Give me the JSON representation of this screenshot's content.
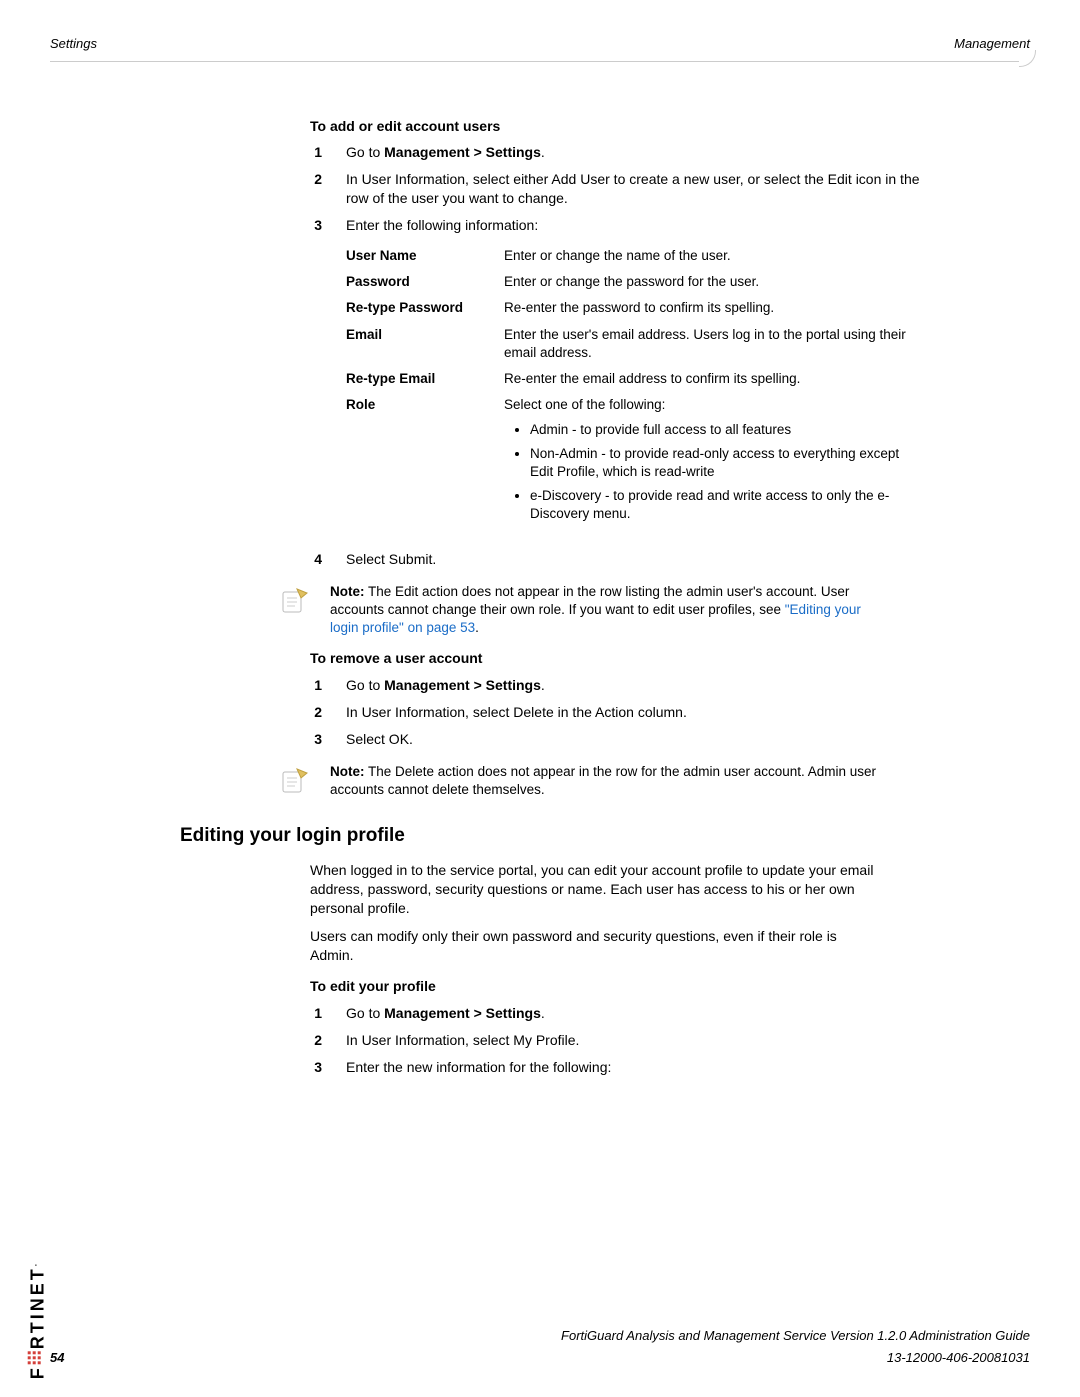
{
  "header": {
    "left": "Settings",
    "right": "Management"
  },
  "sec1": {
    "title": "To add or edit account users",
    "step1_pre": "Go to ",
    "step1_bold": "Management > Settings",
    "step1_post": ".",
    "step2": "In User Information, select either Add User to create a new user, or select the Edit icon in the row of the user you want to change.",
    "step3": "Enter the following information:",
    "table": {
      "r1": {
        "label": "User Name",
        "desc": "Enter or change the name of the user."
      },
      "r2": {
        "label": "Password",
        "desc": "Enter or change the password for the user."
      },
      "r3": {
        "label": "Re-type Password",
        "desc": "Re-enter the password to confirm its spelling."
      },
      "r4": {
        "label": "Email",
        "desc": "Enter the user's email address. Users log in to the portal using their email address."
      },
      "r5": {
        "label": "Re-type Email",
        "desc": "Re-enter the email address to confirm its spelling."
      },
      "r6": {
        "label": "Role",
        "intro": "Select one of the following:",
        "opt1": "Admin - to provide full access to all features",
        "opt2": "Non-Admin - to provide read-only access to everything except Edit Profile, which is read-write",
        "opt3": "e-Discovery - to provide read and write access to only the e-Discovery menu."
      }
    },
    "step4": "Select Submit."
  },
  "note1": {
    "prefix": "Note:",
    "body_a": " The Edit action does not appear in the row listing the admin user's account. User accounts cannot change their own role. If you want to edit user profiles, see ",
    "link": "\"Editing your login profile\" on page 53",
    "body_b": "."
  },
  "sec2": {
    "title": "To remove a user account",
    "step1_pre": "Go to ",
    "step1_bold": "Management > Settings",
    "step1_post": ".",
    "step2": "In User Information, select Delete in the Action column.",
    "step3": "Select OK."
  },
  "note2": {
    "prefix": "Note:",
    "body": " The Delete action does not appear in the row for the admin user account. Admin user accounts cannot delete themselves."
  },
  "sec3": {
    "heading": "Editing your login profile",
    "p1": "When logged in to the service portal, you can edit your account profile to update your email address, password, security questions or name. Each user has access to his or her own personal profile.",
    "p2": "Users can modify only their own password and security questions, even if their role is Admin.",
    "sub_title": "To edit your profile",
    "step1_pre": "Go to ",
    "step1_bold": "Management > Settings",
    "step1_post": ".",
    "step2": "In User Information, select My Profile.",
    "step3": "Enter the new information for the following:"
  },
  "footer": {
    "line1": "FortiGuard Analysis and Management Service Version 1.2.0 Administration Guide",
    "line2": "13-12000-406-20081031",
    "page": "54",
    "brand": "F   RTINET"
  }
}
